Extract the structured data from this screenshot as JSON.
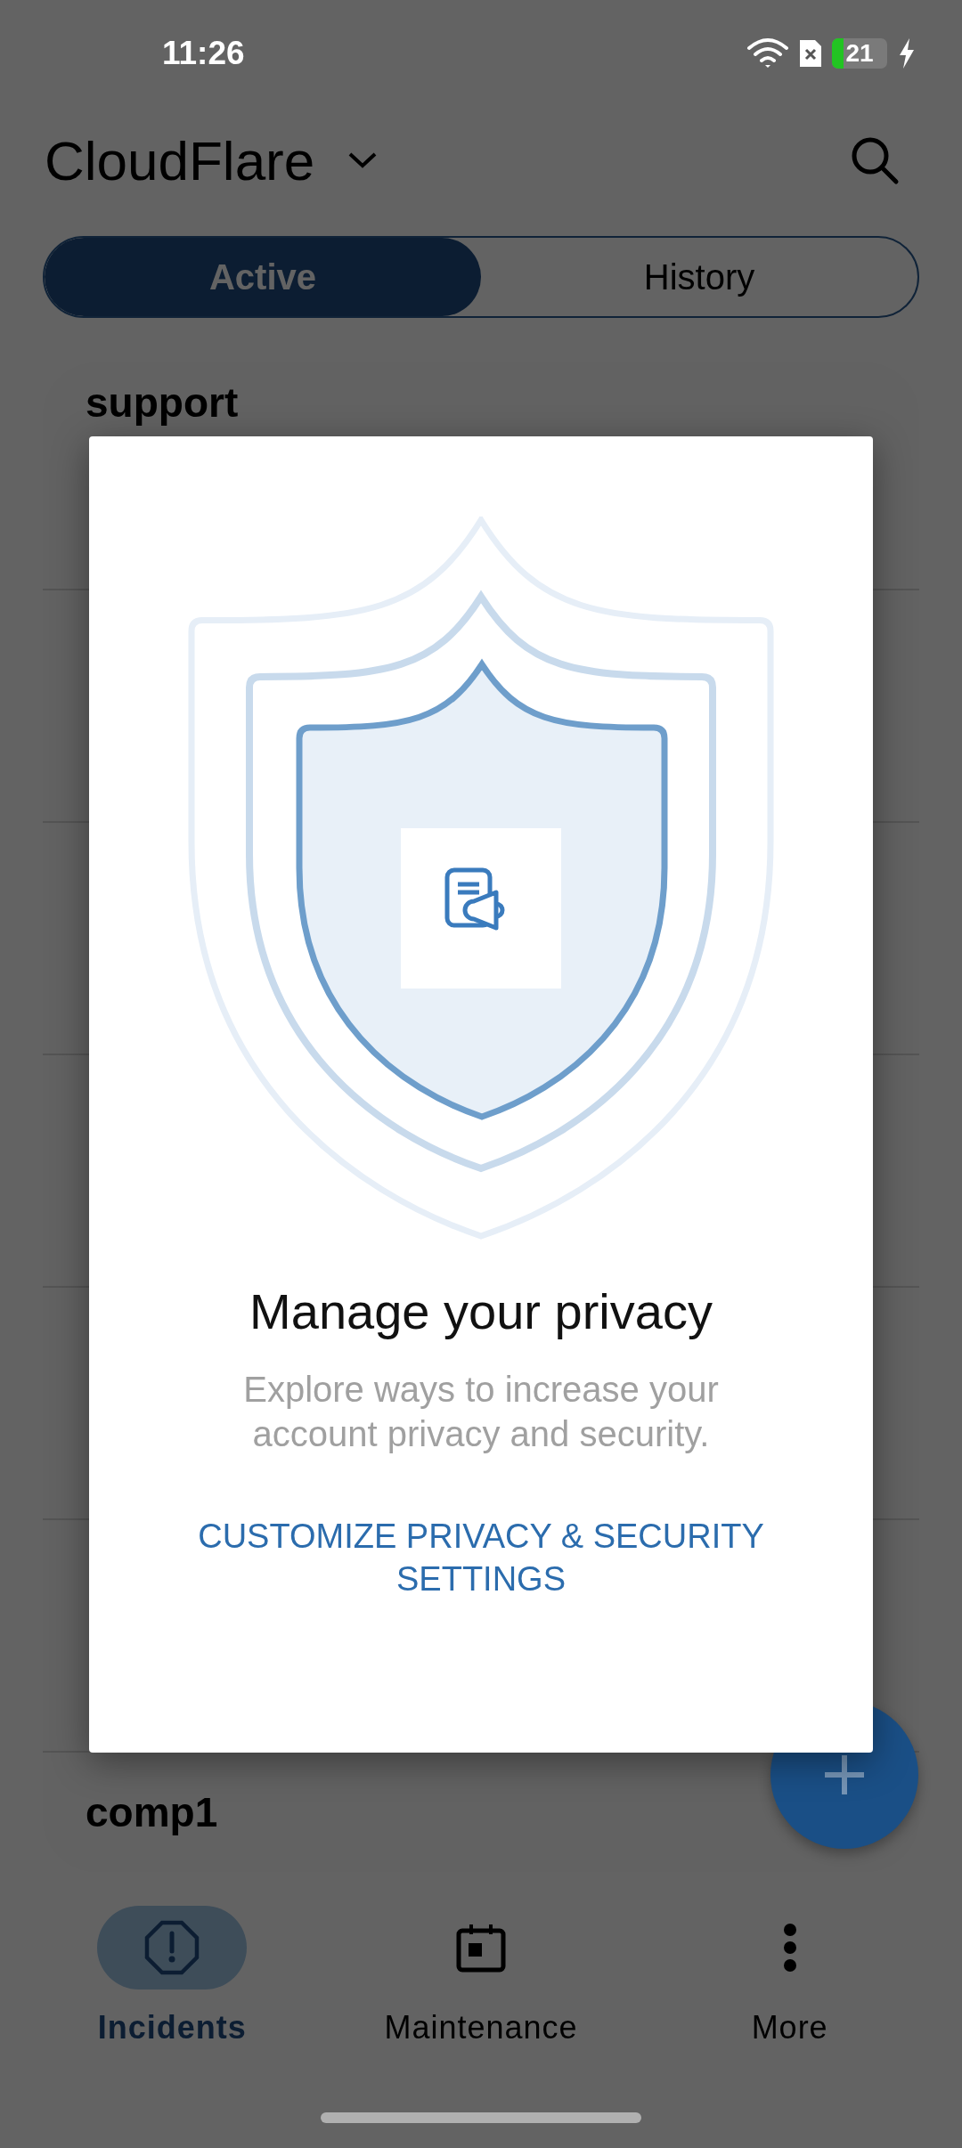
{
  "status_bar": {
    "time": "11:26",
    "battery": "21"
  },
  "header": {
    "title": "CloudFlare"
  },
  "tabs": [
    {
      "label": "Active",
      "selected": true
    },
    {
      "label": "History",
      "selected": false
    }
  ],
  "list": {
    "items": [
      {
        "name": "support"
      },
      {
        "name": "comp1"
      }
    ]
  },
  "dialog": {
    "title": "Manage your privacy",
    "body": "Explore ways to increase your account privacy and security.",
    "link": "CUSTOMIZE PRIVACY & SECURITY SETTINGS"
  },
  "bottom_nav": [
    {
      "label": "Incidents",
      "kind": "incidents",
      "selected": true
    },
    {
      "label": "Maintenance",
      "kind": "maintenance",
      "selected": false
    },
    {
      "label": "More",
      "kind": "more",
      "selected": false
    }
  ]
}
